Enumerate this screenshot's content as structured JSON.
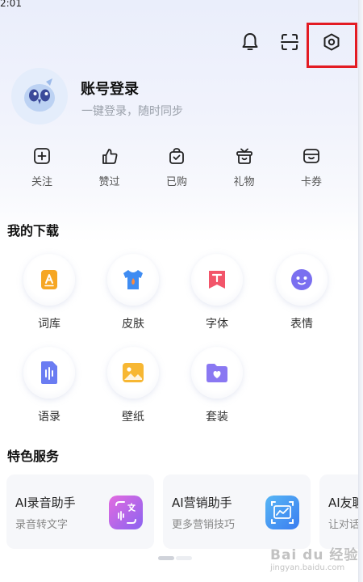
{
  "status_bar": {
    "time": "2:01"
  },
  "header": {
    "icons": [
      "bell-icon",
      "scan-icon",
      "settings-icon"
    ],
    "highlight_color": "#e31b23"
  },
  "account": {
    "title": "账号登录",
    "subtitle": "一键登录，随时同步"
  },
  "quick_actions": [
    {
      "label": "关注",
      "icon": "plus-square-icon"
    },
    {
      "label": "赞过",
      "icon": "thumbs-up-icon"
    },
    {
      "label": "已购",
      "icon": "shopping-bag-icon"
    },
    {
      "label": "礼物",
      "icon": "gift-icon"
    },
    {
      "label": "卡券",
      "icon": "coupon-icon"
    }
  ],
  "downloads": {
    "title": "我的下载",
    "items": [
      {
        "label": "词库",
        "icon": "lexicon-icon",
        "color": "#f6a623"
      },
      {
        "label": "皮肤",
        "icon": "skin-shirt-icon",
        "color": "#3f8cf2"
      },
      {
        "label": "字体",
        "icon": "font-icon",
        "color": "#f2556a"
      },
      {
        "label": "表情",
        "icon": "emoji-face-icon",
        "color": "#7a6ff0"
      },
      {
        "label": "语录",
        "icon": "quote-voice-icon",
        "color": "#6a7cf2"
      },
      {
        "label": "壁纸",
        "icon": "wallpaper-icon",
        "color": "#f7b733"
      },
      {
        "label": "套装",
        "icon": "suite-folder-icon",
        "color": "#8a78f2"
      }
    ]
  },
  "services": {
    "title": "特色服务",
    "cards": [
      {
        "title": "AI录音助手",
        "subtitle": "录音转文字",
        "icon": "voice-translate-icon"
      },
      {
        "title": "AI营销助手",
        "subtitle": "更多营销技巧",
        "icon": "marketing-chart-icon"
      },
      {
        "title": "AI友聊",
        "subtitle": "让对话",
        "icon": "chat-icon"
      }
    ]
  },
  "watermark": {
    "text": "Bai du 经验",
    "sub": "jingyan.baidu.com"
  }
}
